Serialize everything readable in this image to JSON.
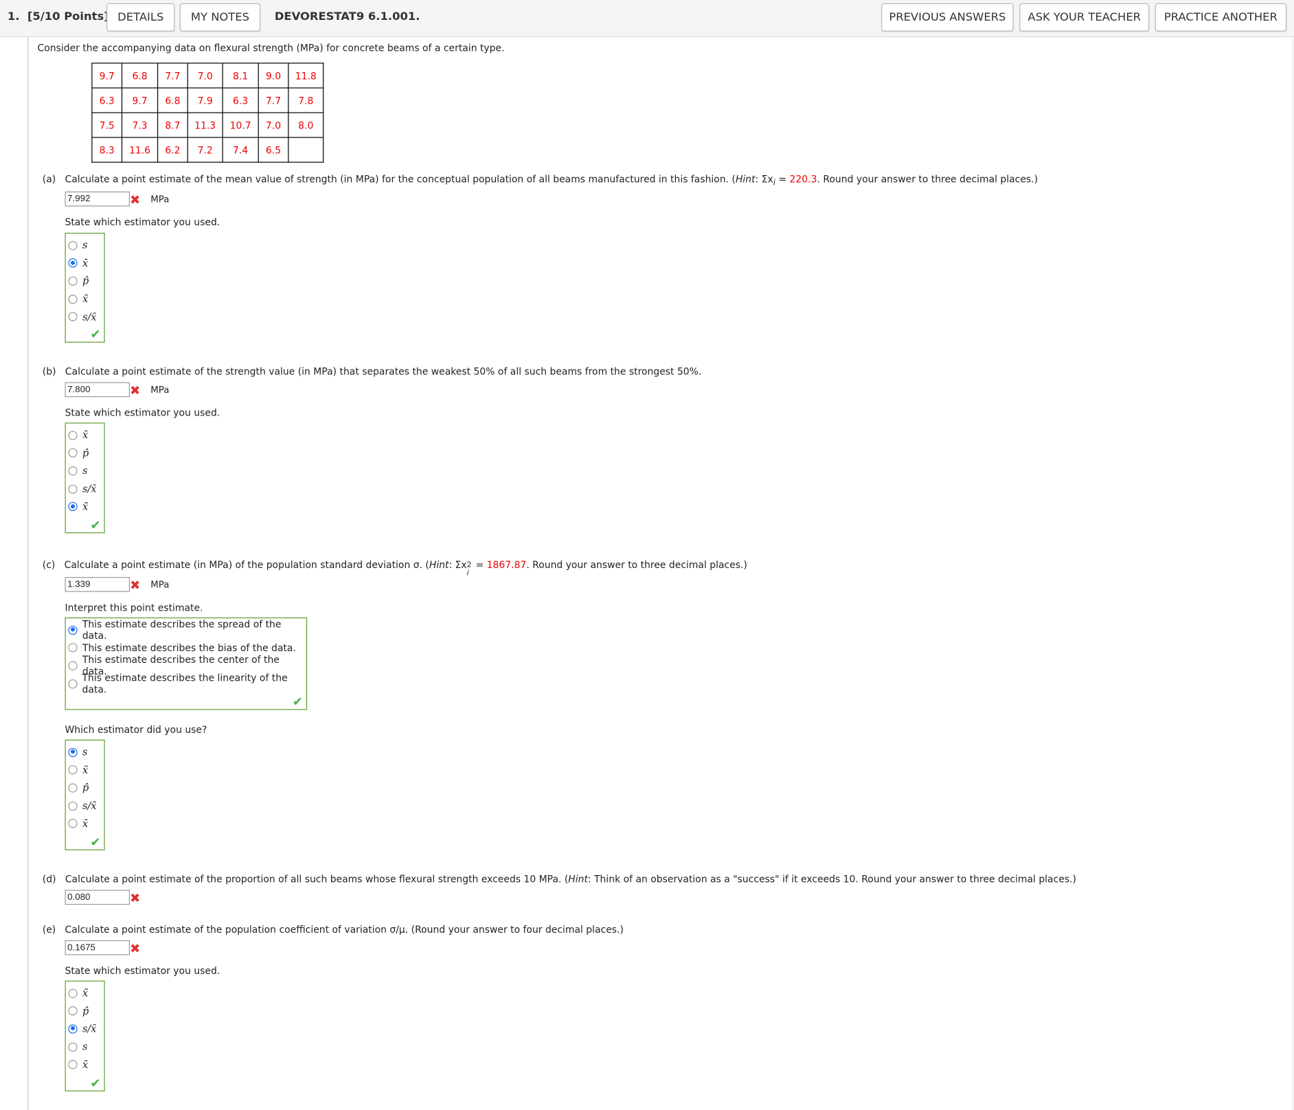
{
  "header": {
    "number": "1.",
    "points": "[5/10 Points]",
    "details": "DETAILS",
    "my_notes": "MY NOTES",
    "code": "DEVORESTAT9 6.1.001.",
    "previous_answers": "PREVIOUS ANSWERS",
    "ask_teacher": "ASK YOUR TEACHER",
    "practice_another": "PRACTICE ANOTHER"
  },
  "intro": "Consider the accompanying data on flexural strength (MPa) for concrete beams of a certain type.",
  "table": [
    [
      "9.7",
      "6.8",
      "7.7",
      "7.0",
      "8.1",
      "9.0",
      "11.8"
    ],
    [
      "6.3",
      "9.7",
      "6.8",
      "7.9",
      "6.3",
      "7.7",
      "7.8"
    ],
    [
      "7.5",
      "7.3",
      "8.7",
      "11.3",
      "10.7",
      "7.0",
      "8.0"
    ],
    [
      "8.3",
      "11.6",
      "6.2",
      "7.2",
      "7.4",
      "6.5",
      ""
    ]
  ],
  "a": {
    "label": "(a)",
    "q1": "Calculate a point estimate of the mean value of strength (in MPa) for the conceptual population of all beams manufactured in this fashion. (",
    "hint": "Hint",
    "q2": ": Σx",
    "sub": "i",
    "q3": " = ",
    "val": "220.3",
    "q4": ". Round your answer to three decimal places.)",
    "answer": "7.992",
    "unit": "MPa",
    "state": "State which estimator you used.",
    "options": [
      "s",
      "x̄",
      "p̂",
      "x̃",
      "s/x̄"
    ],
    "selected": 1
  },
  "b": {
    "label": "(b)",
    "q": "Calculate a point estimate of the strength value (in MPa) that separates the weakest 50% of all such beams from the strongest 50%.",
    "answer": "7.800",
    "unit": "MPa",
    "state": "State which estimator you used.",
    "options": [
      "x̄",
      "p̂",
      "s",
      "s/x̄",
      "x̃"
    ],
    "selected": 4
  },
  "c": {
    "label": "(c)",
    "q1": "Calculate a point estimate (in MPa) of the population standard deviation σ. (",
    "hint": "Hint",
    "q2": ": Σx",
    "sub": "i",
    "sup": "2",
    "q3": " = ",
    "val": "1867.87",
    "q4": ". Round your answer to three decimal places.)",
    "answer": "1.339",
    "unit": "MPa",
    "interpret": "Interpret this point estimate.",
    "interp_options": [
      "This estimate describes the spread of the data.",
      "This estimate describes the bias of the data.",
      "This estimate describes the center of the data.",
      "This estimate describes the linearity of the data."
    ],
    "interp_selected": 0,
    "which": "Which estimator did you use?",
    "options": [
      "s",
      "x̃",
      "p̂",
      "s/x̄",
      "x̄"
    ],
    "selected": 0
  },
  "d": {
    "label": "(d)",
    "q1": "Calculate a point estimate of the proportion of all such beams whose flexural strength exceeds 10 MPa. (",
    "hint": "Hint",
    "q2": ": Think of an observation as a \"success\" if it exceeds 10. Round your answer to three decimal places.)",
    "answer": "0.080"
  },
  "e": {
    "label": "(e)",
    "q": "Calculate a point estimate of the population coefficient of variation σ/μ. (Round your answer to four decimal places.)",
    "answer": "0.1675",
    "state": "State which estimator you used.",
    "options": [
      "x̃",
      "p̂",
      "s/x̄",
      "s",
      "x̄"
    ],
    "selected": 2
  },
  "icons": {
    "wrong": "✖",
    "correct": "✔"
  }
}
